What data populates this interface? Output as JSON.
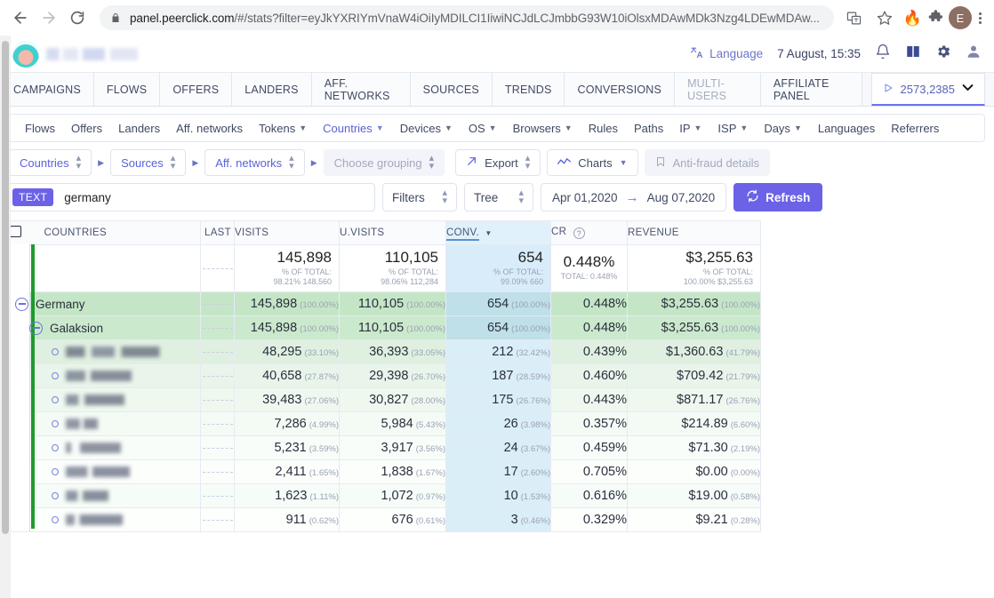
{
  "browser": {
    "url_bold": "panel.peerclick.com",
    "url_rest": "/#/stats?filter=eyJkYXRIYmVnaW4iOiIyMDILCI1IiwiNCJdLCJmbbG93W10iOlsxMDAwMDk3Nzg4LDEwMDAw...",
    "back_icon": "back-arrow-icon",
    "forward_icon": "forward-arrow-icon",
    "reload_icon": "reload-icon",
    "lock_icon": "lock-icon",
    "translate_icon": "translate-icon",
    "bookmark_icon": "star-icon",
    "extension_icons": [
      "flame-icon",
      "puzzle-icon"
    ],
    "profile_initial": "E"
  },
  "header": {
    "language_label": "Language",
    "datetime": "7 August, 15:35",
    "icons": [
      "bell-icon",
      "book-icon",
      "gear-icon",
      "user-icon"
    ]
  },
  "main_tabs": [
    {
      "label": "CAMPAIGNS",
      "muted": false
    },
    {
      "label": "FLOWS",
      "muted": false
    },
    {
      "label": "OFFERS",
      "muted": false
    },
    {
      "label": "LANDERS",
      "muted": false
    },
    {
      "label": "AFF. NETWORKS",
      "muted": false
    },
    {
      "label": "SOURCES",
      "muted": false
    },
    {
      "label": "TRENDS",
      "muted": false
    },
    {
      "label": "CONVERSIONS",
      "muted": false
    },
    {
      "label": "MULTI-USERS",
      "muted": true
    },
    {
      "label": "AFFILIATE PANEL",
      "muted": false
    }
  ],
  "campaign_select": {
    "value": "2573,2385",
    "play_icon": "play-triangle-icon",
    "caret": "⌄"
  },
  "subnav": [
    {
      "label": "Flows",
      "dropdown": false,
      "active": false
    },
    {
      "label": "Offers",
      "dropdown": false,
      "active": false
    },
    {
      "label": "Landers",
      "dropdown": false,
      "active": false
    },
    {
      "label": "Aff. networks",
      "dropdown": false,
      "active": false
    },
    {
      "label": "Tokens",
      "dropdown": true,
      "active": false
    },
    {
      "label": "Countries",
      "dropdown": true,
      "active": true
    },
    {
      "label": "Devices",
      "dropdown": true,
      "active": false
    },
    {
      "label": "OS",
      "dropdown": true,
      "active": false
    },
    {
      "label": "Browsers",
      "dropdown": true,
      "active": false
    },
    {
      "label": "Rules",
      "dropdown": false,
      "active": false
    },
    {
      "label": "Paths",
      "dropdown": false,
      "active": false
    },
    {
      "label": "IP",
      "dropdown": true,
      "active": false
    },
    {
      "label": "ISP",
      "dropdown": true,
      "active": false
    },
    {
      "label": "Days",
      "dropdown": true,
      "active": false
    },
    {
      "label": "Languages",
      "dropdown": false,
      "active": false
    },
    {
      "label": "Referrers",
      "dropdown": false,
      "active": false
    }
  ],
  "grouping": {
    "level1": "Countries",
    "level2": "Sources",
    "level3": "Aff. networks",
    "placeholder": "Choose grouping",
    "export_label": "Export",
    "charts_label": "Charts",
    "antifraud_label": "Anti-fraud details",
    "export_icon": "export-arrow-icon",
    "charts_icon": "line-chart-icon",
    "antifraud_icon": "bookmark-outline-icon"
  },
  "filterbar": {
    "text_badge": "TEXT",
    "search_value": "germany",
    "search_placeholder": "",
    "filters_label": "Filters",
    "tree_label": "Tree",
    "date_from": "Apr 01,2020",
    "date_to": "Aug 07,2020",
    "date_arrow": "→",
    "refresh_label": "Refresh",
    "refresh_icon": "refresh-icon"
  },
  "table": {
    "columns": [
      {
        "key": "countries",
        "label": "COUNTRIES"
      },
      {
        "key": "last",
        "label": "LAST"
      },
      {
        "key": "visits",
        "label": "VISITS"
      },
      {
        "key": "uvisits",
        "label": "U.VISITS"
      },
      {
        "key": "conv",
        "label": "CONV.",
        "sorted": true,
        "sort_dir": "desc"
      },
      {
        "key": "cr",
        "label": "CR",
        "help": true
      },
      {
        "key": "revenue",
        "label": "REVENUE"
      }
    ],
    "totals": {
      "visits": {
        "value": "145,898",
        "sub1": "% OF TOTAL:",
        "sub2": "98.21% 148,560"
      },
      "uvisits": {
        "value": "110,105",
        "sub1": "% OF TOTAL:",
        "sub2": "98.06% 112,284"
      },
      "conv": {
        "value": "654",
        "sub1": "% OF TOTAL:",
        "sub2": "99.09% 660"
      },
      "cr": {
        "value": "0.448%",
        "sub1": "TOTAL: 0.448%",
        "sub2": ""
      },
      "revenue": {
        "value": "$3,255.63",
        "sub1": "% OF TOTAL:",
        "sub2": "100.00% $3,255.63"
      }
    },
    "rows": [
      {
        "level": 0,
        "name": "Germany",
        "blurred": false,
        "expander": "minus",
        "visits": "145,898",
        "visits_pct": "(100.00%)",
        "uvisits": "110,105",
        "uvisits_pct": "(100.00%)",
        "conv": "654",
        "conv_pct": "(100.00%)",
        "cr": "0.448%",
        "revenue": "$3,255.63",
        "revenue_pct": "(100.00%)"
      },
      {
        "level": 1,
        "name": "Galaksion",
        "blurred": false,
        "expander": "minus",
        "visits": "145,898",
        "visits_pct": "(100.00%)",
        "uvisits": "110,105",
        "uvisits_pct": "(100.00%)",
        "conv": "654",
        "conv_pct": "(100.00%)",
        "cr": "0.448%",
        "revenue": "$3,255.63",
        "revenue_pct": "(100.00%)"
      },
      {
        "level": 2,
        "name": "",
        "blurred": true,
        "expander": "bullet",
        "visits": "48,295",
        "visits_pct": "(33.10%)",
        "uvisits": "36,393",
        "uvisits_pct": "(33.05%)",
        "conv": "212",
        "conv_pct": "(32.42%)",
        "cr": "0.439%",
        "revenue": "$1,360.63",
        "revenue_pct": "(41.79%)"
      },
      {
        "level": 2,
        "name": "",
        "blurred": true,
        "expander": "bullet",
        "visits": "40,658",
        "visits_pct": "(27.87%)",
        "uvisits": "29,398",
        "uvisits_pct": "(26.70%)",
        "conv": "187",
        "conv_pct": "(28.59%)",
        "cr": "0.460%",
        "revenue": "$709.42",
        "revenue_pct": "(21.79%)"
      },
      {
        "level": 2,
        "name": "",
        "blurred": true,
        "expander": "bullet",
        "visits": "39,483",
        "visits_pct": "(27.06%)",
        "uvisits": "30,827",
        "uvisits_pct": "(28.00%)",
        "conv": "175",
        "conv_pct": "(26.76%)",
        "cr": "0.443%",
        "revenue": "$871.17",
        "revenue_pct": "(26.76%)"
      },
      {
        "level": 2,
        "name": "",
        "blurred": true,
        "expander": "bullet",
        "visits": "7,286",
        "visits_pct": "(4.99%)",
        "uvisits": "5,984",
        "uvisits_pct": "(5.43%)",
        "conv": "26",
        "conv_pct": "(3.98%)",
        "cr": "0.357%",
        "revenue": "$214.89",
        "revenue_pct": "(6.60%)"
      },
      {
        "level": 2,
        "name": "",
        "blurred": true,
        "expander": "bullet",
        "visits": "5,231",
        "visits_pct": "(3.59%)",
        "uvisits": "3,917",
        "uvisits_pct": "(3.56%)",
        "conv": "24",
        "conv_pct": "(3.67%)",
        "cr": "0.459%",
        "revenue": "$71.30",
        "revenue_pct": "(2.19%)"
      },
      {
        "level": 2,
        "name": "",
        "blurred": true,
        "expander": "bullet",
        "visits": "2,411",
        "visits_pct": "(1.65%)",
        "uvisits": "1,838",
        "uvisits_pct": "(1.67%)",
        "conv": "17",
        "conv_pct": "(2.60%)",
        "cr": "0.705%",
        "revenue": "$0.00",
        "revenue_pct": "(0.00%)"
      },
      {
        "level": 2,
        "name": "",
        "blurred": true,
        "expander": "bullet",
        "visits": "1,623",
        "visits_pct": "(1.11%)",
        "uvisits": "1,072",
        "uvisits_pct": "(0.97%)",
        "conv": "10",
        "conv_pct": "(1.53%)",
        "cr": "0.616%",
        "revenue": "$19.00",
        "revenue_pct": "(0.58%)"
      },
      {
        "level": 2,
        "name": "",
        "blurred": true,
        "expander": "bullet",
        "visits": "911",
        "visits_pct": "(0.62%)",
        "uvisits": "676",
        "uvisits_pct": "(0.61%)",
        "conv": "3",
        "conv_pct": "(0.46%)",
        "cr": "0.329%",
        "revenue": "$9.21",
        "revenue_pct": "(0.28%)"
      }
    ]
  }
}
